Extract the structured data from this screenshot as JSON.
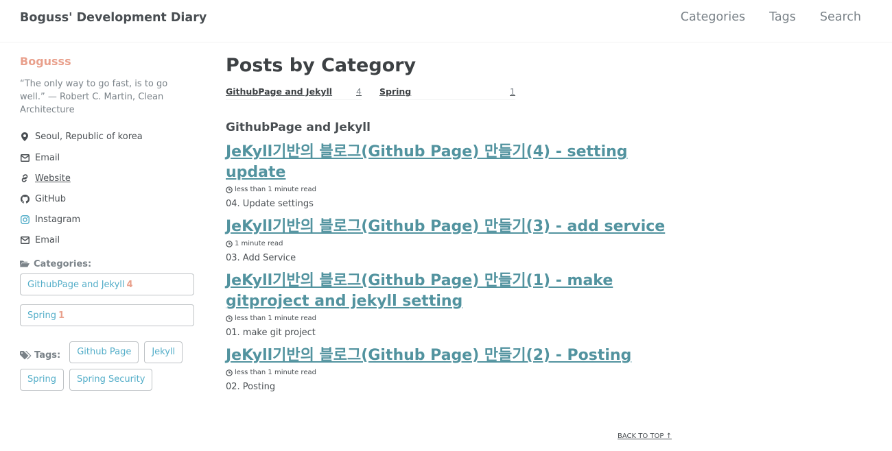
{
  "site": {
    "title": "Boguss' Development Diary"
  },
  "nav": {
    "items": [
      "Categories",
      "Tags",
      "Search"
    ]
  },
  "author": {
    "name": "Bogusss",
    "bio": "“The only way to go fast, is to go well.” — Robert C. Martin, Clean Architecture",
    "location": "Seoul, Republic of korea",
    "links": [
      {
        "label": "Email",
        "icon": "envelope-icon"
      },
      {
        "label": "Website",
        "icon": "link-icon"
      },
      {
        "label": "GitHub",
        "icon": "github-icon"
      },
      {
        "label": "Instagram",
        "icon": "instagram-icon"
      },
      {
        "label": "Email",
        "icon": "envelope-icon"
      }
    ]
  },
  "sidebar_categories": {
    "title": "Categories:",
    "items": [
      {
        "label": "GithubPage and Jekyll",
        "count": "4"
      },
      {
        "label": "Spring",
        "count": "1"
      }
    ]
  },
  "sidebar_tags": {
    "title": "Tags:",
    "items": [
      "Github Page",
      "Jekyll",
      "Spring",
      "Spring Security"
    ]
  },
  "main": {
    "title": "Posts by Category",
    "taxonomy": [
      {
        "name": "GithubPage and Jekyll",
        "count": "4"
      },
      {
        "name": "Spring",
        "count": "1"
      }
    ],
    "section_title": "GithubPage and Jekyll",
    "posts": [
      {
        "title": "JeKyll기반의 블로그(Github Page) 만들기(4) - setting update",
        "read_time": "less than 1 minute read",
        "excerpt": "04. Update settings"
      },
      {
        "title": "JeKyll기반의 블로그(Github Page) 만들기(3) - add service",
        "read_time": "1 minute read",
        "excerpt": "03. Add Service"
      },
      {
        "title": "JeKyll기반의 블로그(Github Page) 만들기(1) - make gitproject and jekyll setting",
        "read_time": "less than 1 minute read",
        "excerpt": "01. make git project"
      },
      {
        "title": "JeKyll기반의 블로그(Github Page) 만들기(2) - Posting",
        "read_time": "less than 1 minute read",
        "excerpt": "02. Posting"
      }
    ],
    "back_to_top": "BACK TO TOP ↑"
  },
  "colors": {
    "accent": "#e9a08c",
    "link": "#52939f",
    "tag_text": "#52adc8"
  }
}
